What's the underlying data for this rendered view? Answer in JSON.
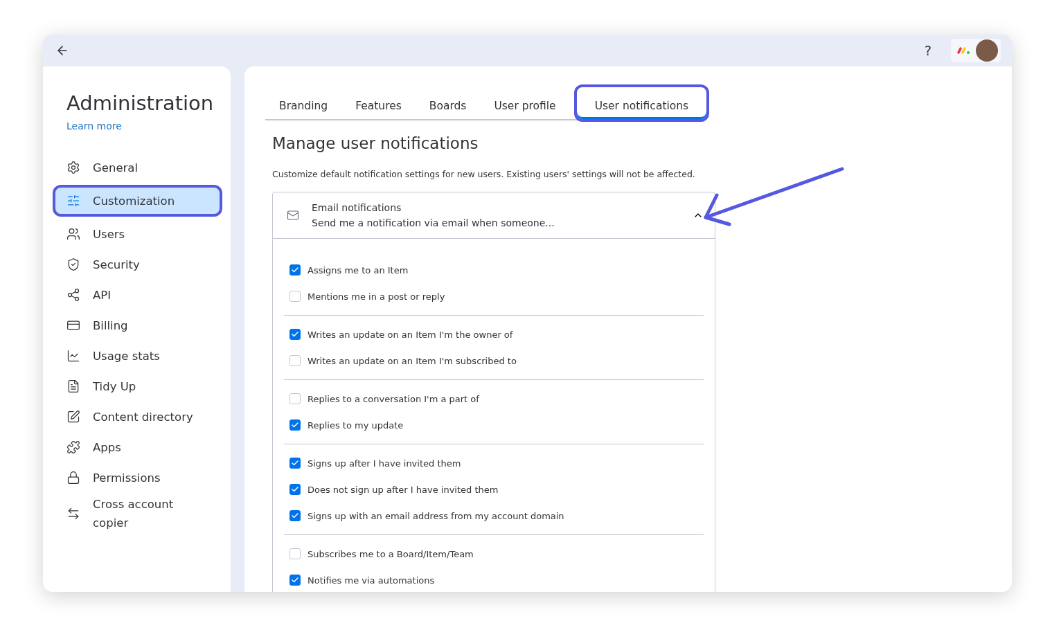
{
  "top_bar": {
    "help": "?"
  },
  "sidebar": {
    "title": "Administration",
    "link": "Learn more",
    "items": [
      {
        "label": "General",
        "selected": false
      },
      {
        "label": "Customization",
        "selected": true
      },
      {
        "label": "Users",
        "selected": false
      },
      {
        "label": "Security",
        "selected": false
      },
      {
        "label": "API",
        "selected": false
      },
      {
        "label": "Billing",
        "selected": false
      },
      {
        "label": "Usage stats",
        "selected": false
      },
      {
        "label": "Tidy Up",
        "selected": false
      },
      {
        "label": "Content directory",
        "selected": false
      },
      {
        "label": "Apps",
        "selected": false
      },
      {
        "label": "Permissions",
        "selected": false
      },
      {
        "label": "Cross account copier",
        "selected": false
      }
    ]
  },
  "tabs": [
    {
      "label": "Branding",
      "selected": false
    },
    {
      "label": "Features",
      "selected": false
    },
    {
      "label": "Boards",
      "selected": false
    },
    {
      "label": "User profile",
      "selected": false
    },
    {
      "label": "User notifications",
      "selected": true
    }
  ],
  "heading": "Manage user notifications",
  "description": "Customize default notification settings for new users. Existing users' settings will not be affected.",
  "section": {
    "title": "Email notifications",
    "subtitle": "Send me a notification via email when someone...",
    "expanded": true,
    "groups": [
      [
        {
          "label": "Assigns me to an Item",
          "checked": true
        },
        {
          "label": "Mentions me in a post or reply",
          "checked": false
        }
      ],
      [
        {
          "label": "Writes an update on an Item I'm the owner of",
          "checked": true
        },
        {
          "label": "Writes an update on an Item I'm subscribed to",
          "checked": false
        }
      ],
      [
        {
          "label": "Replies to a conversation I'm a part of",
          "checked": false
        },
        {
          "label": "Replies to my update",
          "checked": true
        }
      ],
      [
        {
          "label": "Signs up after I have invited them",
          "checked": true
        },
        {
          "label": "Does not sign up after I have invited them",
          "checked": true
        },
        {
          "label": "Signs up with an email address from my account domain",
          "checked": true
        }
      ],
      [
        {
          "label": "Subscribes me to a Board/Item/Team",
          "checked": false
        },
        {
          "label": "Notifies me via automations",
          "checked": true
        }
      ]
    ]
  }
}
